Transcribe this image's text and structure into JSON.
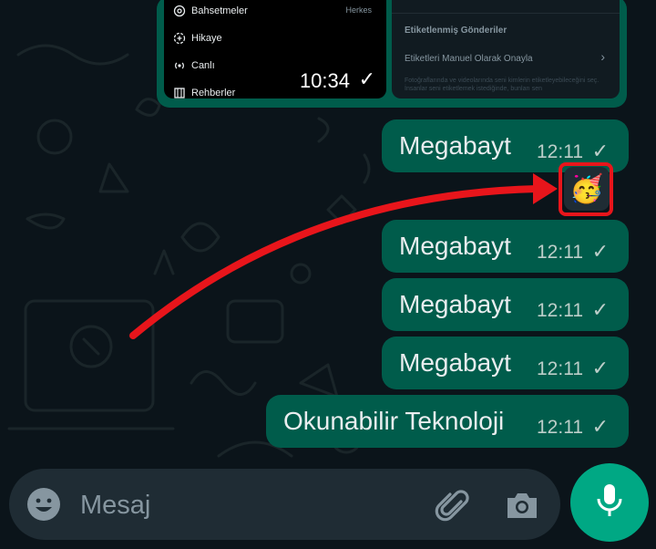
{
  "shared_screenshot": {
    "menu_items": [
      {
        "label": "Bahsetmeler",
        "icon": "at-icon"
      },
      {
        "label": "Hikaye",
        "icon": "story-plus-icon"
      },
      {
        "label": "Canlı",
        "icon": "live-icon"
      },
      {
        "label": "Rehberler",
        "icon": "guide-icon"
      }
    ],
    "audience": "Herkes",
    "time": "10:34",
    "right_panel": {
      "section_title": "Etiketlenmiş Gönderiler",
      "row_label": "Etiketleri Manuel Olarak Onayla",
      "footnote": "Fotoğraflarında ve videolarında seni kimlerin etiketleyebileceğini seç. İnsanlar seni etiketlemek istediğinde, bunları sen"
    }
  },
  "messages": [
    {
      "text": "Megabayt",
      "time": "12:11",
      "status": "sent"
    },
    {
      "text": "Megabayt",
      "time": "12:11",
      "status": "sent"
    },
    {
      "text": "Megabayt",
      "time": "12:11",
      "status": "sent"
    },
    {
      "text": "Megabayt",
      "time": "12:11",
      "status": "sent"
    },
    {
      "text": "Okunabilir Teknoloji",
      "time": "12:11",
      "status": "sent"
    }
  ],
  "reaction": {
    "emoji": "🥳"
  },
  "composer": {
    "placeholder": "Mesaj"
  },
  "colors": {
    "background": "#0b141a",
    "outgoing_bubble": "#005c4b",
    "accent": "#00a884",
    "annotation": "#e8151b"
  }
}
